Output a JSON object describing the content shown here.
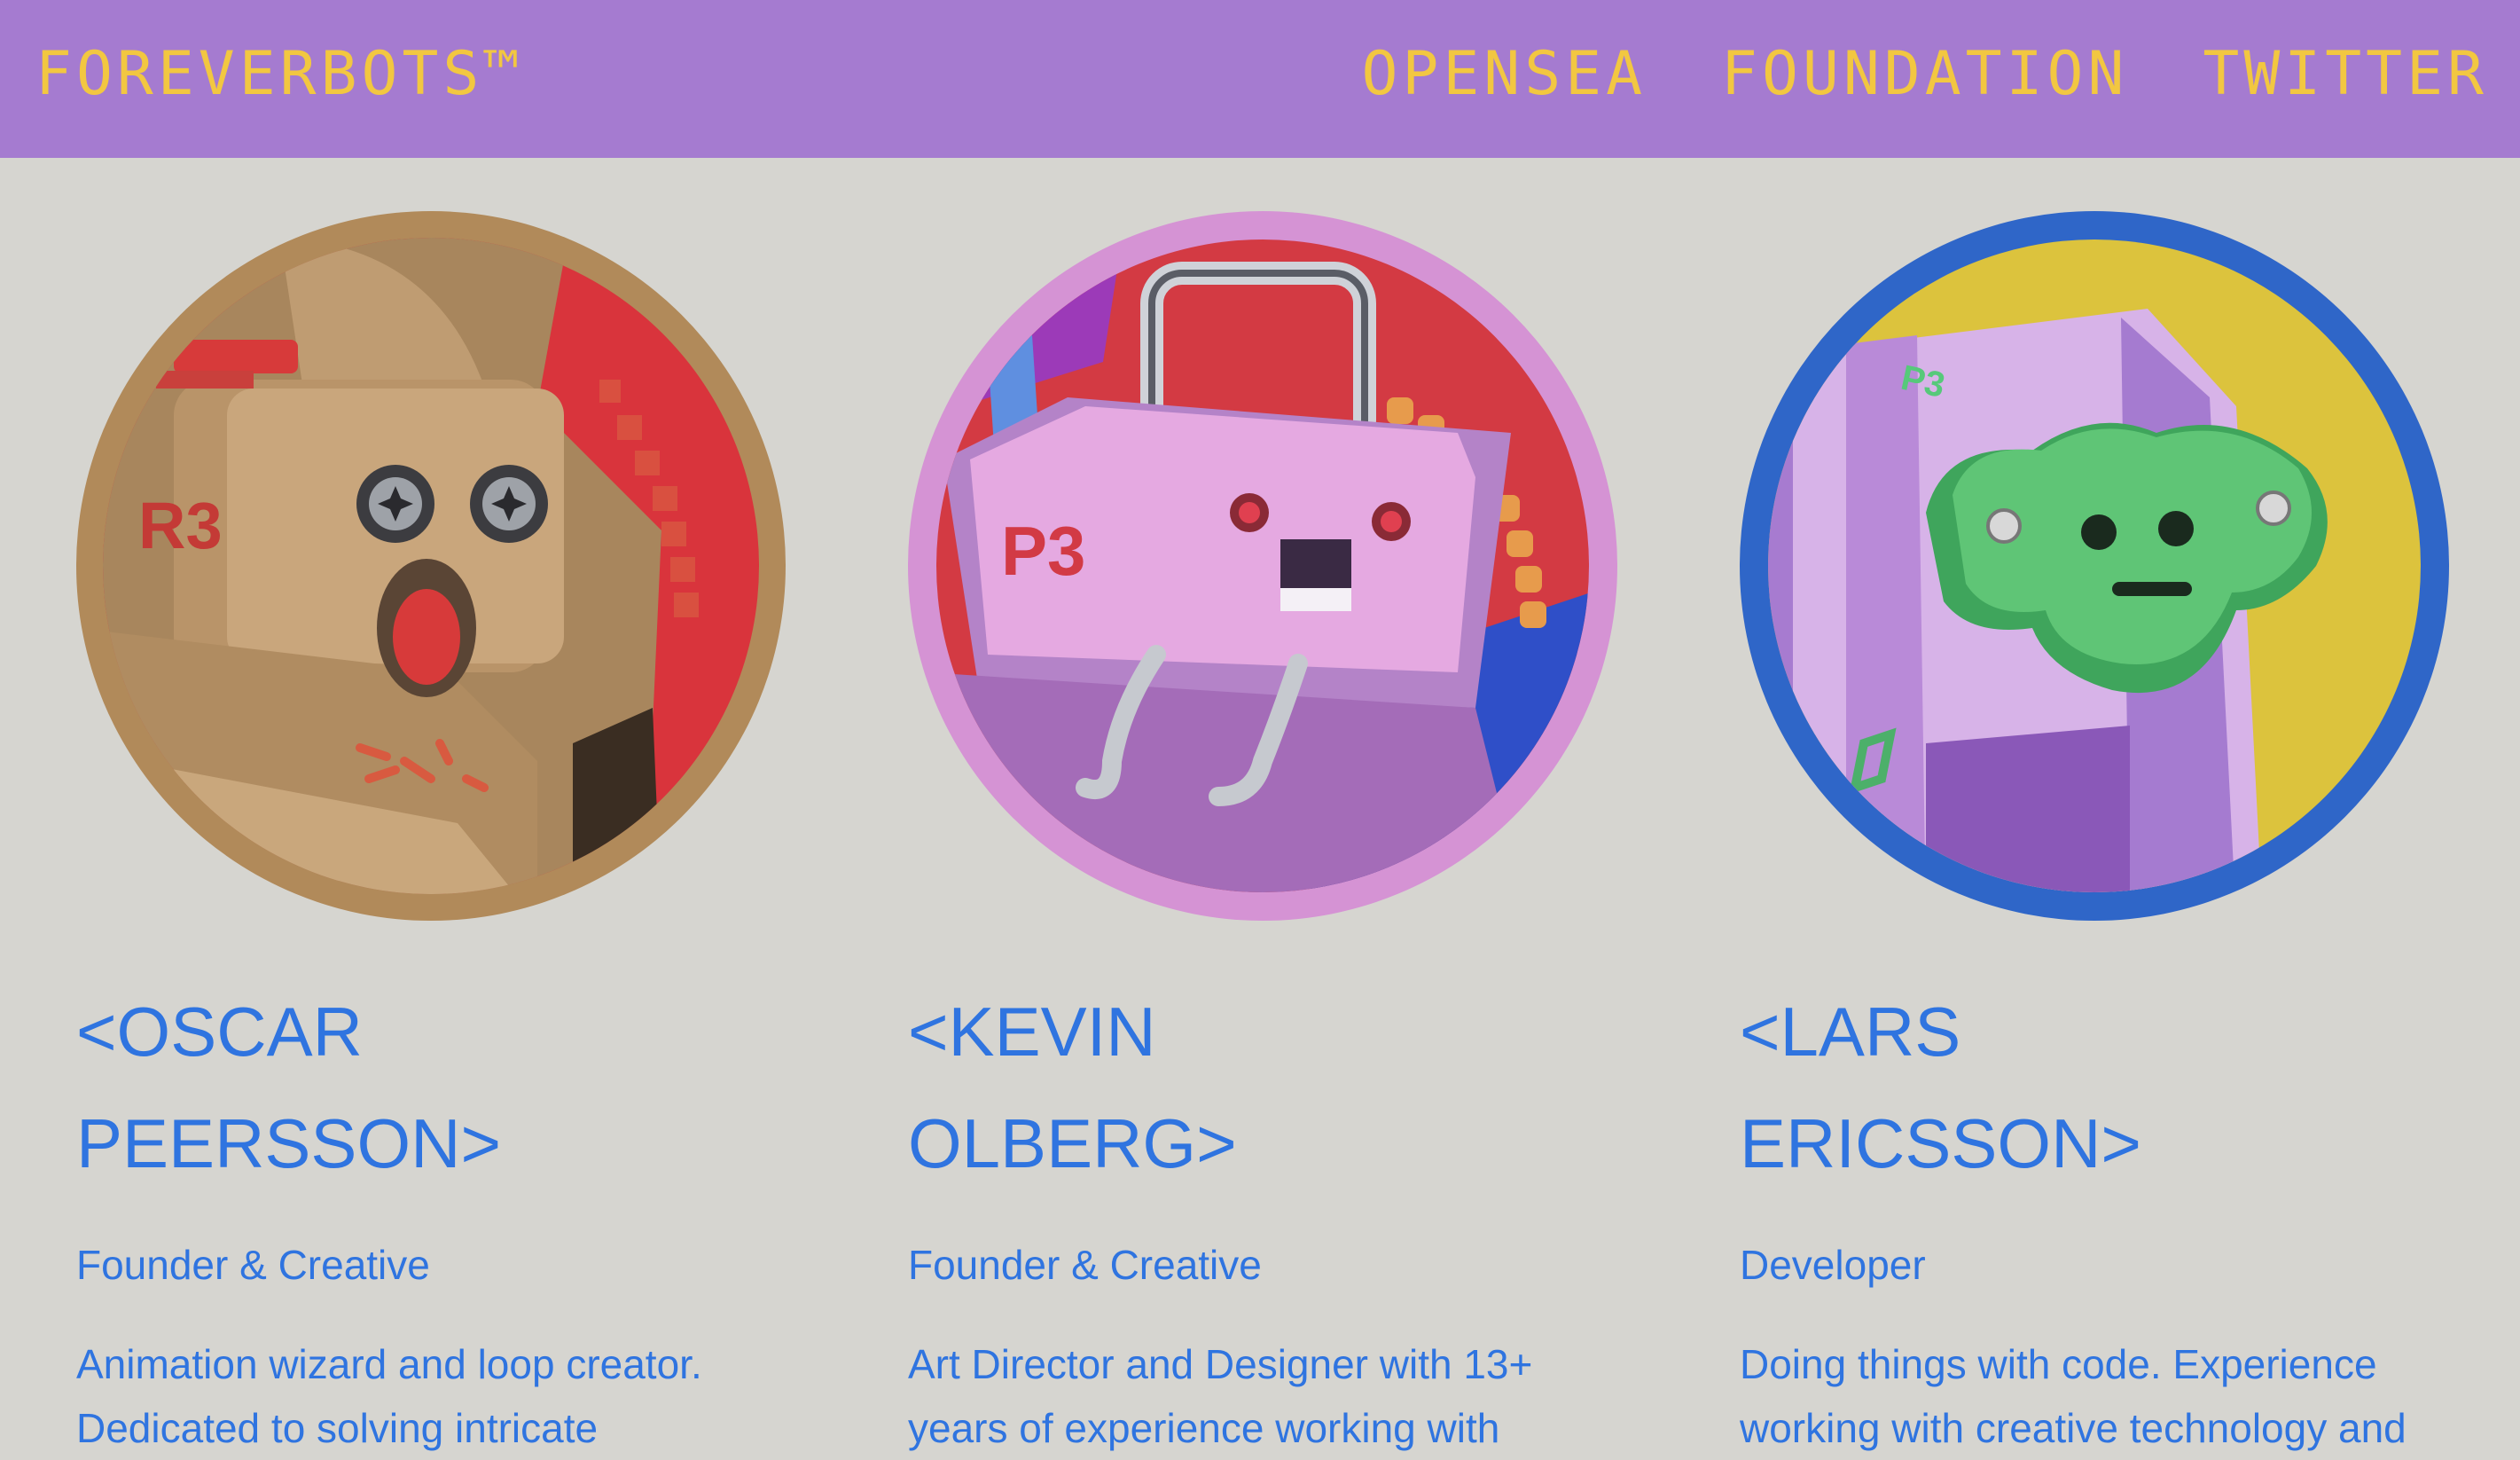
{
  "header": {
    "brand": "FOREVERBOTS™",
    "nav": [
      "OPENSEA",
      "FOUNDATION",
      "TWITTER"
    ]
  },
  "colors": {
    "header_bg": "#a57bd0",
    "header_text": "#f2c741",
    "page_bg": "#d6d5d0",
    "accent_text": "#2f74e0"
  },
  "team": [
    {
      "name_line1": "<OSCAR",
      "name_line2": "PEERSSON>",
      "role": "Founder & Creative",
      "bio_line1": "Animation wizard and loop creator.",
      "bio_line2": "Dedicated to solving intricate",
      "bot_label": "R3",
      "ring_color": "#b18a5a"
    },
    {
      "name_line1": "<KEVIN",
      "name_line2": "OLBERG>",
      "role": "Founder & Creative",
      "bio_line1": "Art Director and Designer with 13+",
      "bio_line2": "years of experience working with",
      "bot_label": "P3",
      "ring_color": "#d593d4"
    },
    {
      "name_line1": "<LARS",
      "name_line2": "ERICSSON>",
      "role": "Developer",
      "bio_line1": "Doing things with code. Experience",
      "bio_line2": "working with creative technology and",
      "bot_label": "P3",
      "ring_color": "#2f66c8"
    }
  ]
}
